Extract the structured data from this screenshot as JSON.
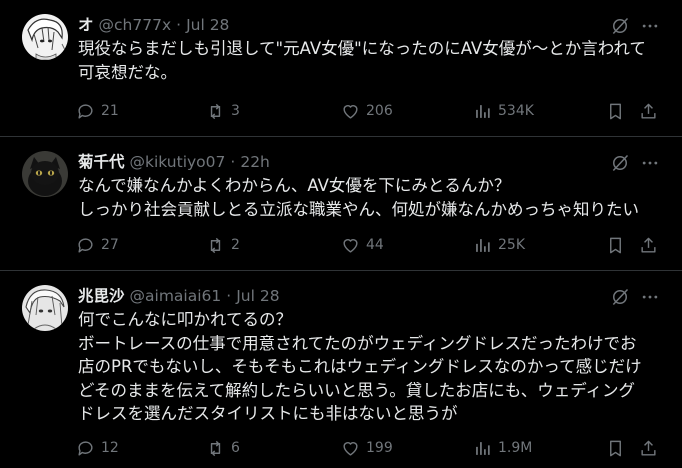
{
  "tweets": [
    {
      "name": "オ",
      "handle": "@ch777x",
      "sep": "·",
      "time": "Jul 28",
      "lines": [
        "現役ならまだしも引退して\"元AV女優\"になったのにAV女優が〜とか言われて",
        "可哀想だな。"
      ],
      "stats": {
        "replies": "21",
        "reposts": "3",
        "likes": "206",
        "views": "534K"
      }
    },
    {
      "name": "菊千代",
      "handle": "@kikutiyo07",
      "sep": "·",
      "time": "22h",
      "lines": [
        "なんで嫌なんかよくわからん、AV女優を下にみとるんか？",
        "しっかり社会貢献しとる立派な職業やん、何処が嫌なんかめっちゃ知りたい"
      ],
      "stats": {
        "replies": "27",
        "reposts": "2",
        "likes": "44",
        "views": "25K"
      }
    },
    {
      "name": "兆毘沙",
      "handle": "@aimaiai61",
      "sep": "·",
      "time": "Jul 28",
      "lines": [
        "何でこんなに叩かれてるの？",
        "ボートレースの仕事で用意されてたのがウェディングドレスだったわけでお",
        "店のPRでもないし、そもそもこれはウェディングドレスなのかって感じだけ",
        "どそのままを伝えて解約したらいいと思う。貸したお店にも、ウェディング",
        "ドレスを選んだスタイリストにも非はないと思うが"
      ],
      "stats": {
        "replies": "12",
        "reposts": "6",
        "likes": "199",
        "views": "1.9M"
      }
    }
  ],
  "icons": {
    "avatar": "avatar",
    "grok": "grok-icon",
    "more": "more-icon",
    "reply": "reply-icon",
    "repost": "repost-icon",
    "like": "like-icon",
    "views": "views-icon",
    "bookmark": "bookmark-icon",
    "share": "share-icon"
  },
  "colors": {
    "background": "#000000",
    "text": "#e7e9ea",
    "muted": "#71767b",
    "divider": "#2f3336"
  }
}
